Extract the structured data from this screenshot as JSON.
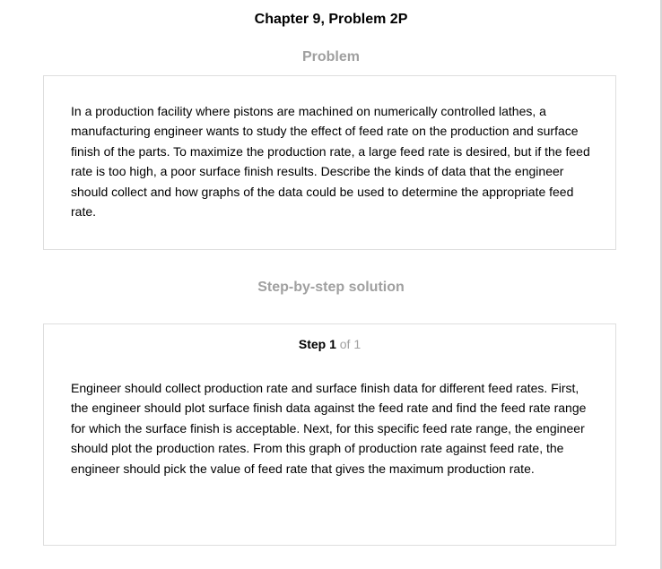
{
  "chapter_title": "Chapter 9, Problem 2P",
  "problem": {
    "heading": "Problem",
    "text": "In a production facility where pistons are machined on numerically controlled lathes, a manufacturing engineer wants to study the effect of feed rate on the production and surface finish of the parts. To maximize the production rate, a large feed rate is desired, but if the feed rate is too high, a poor surface finish results. Describe the kinds of data that the engineer should collect and how graphs of the data could be used to determine the appropriate feed rate."
  },
  "solution": {
    "heading": "Step-by-step solution",
    "step_label": "Step 1",
    "step_of": "of 1",
    "text": "Engineer should collect production rate and surface finish data for different feed rates. First, the engineer should plot surface finish data against the feed rate and find the feed rate range for which the surface finish is acceptable. Next, for this specific feed rate range, the engineer should plot the production rates. From this graph of production rate against feed rate, the engineer should pick the value of feed rate that gives the maximum production rate."
  }
}
